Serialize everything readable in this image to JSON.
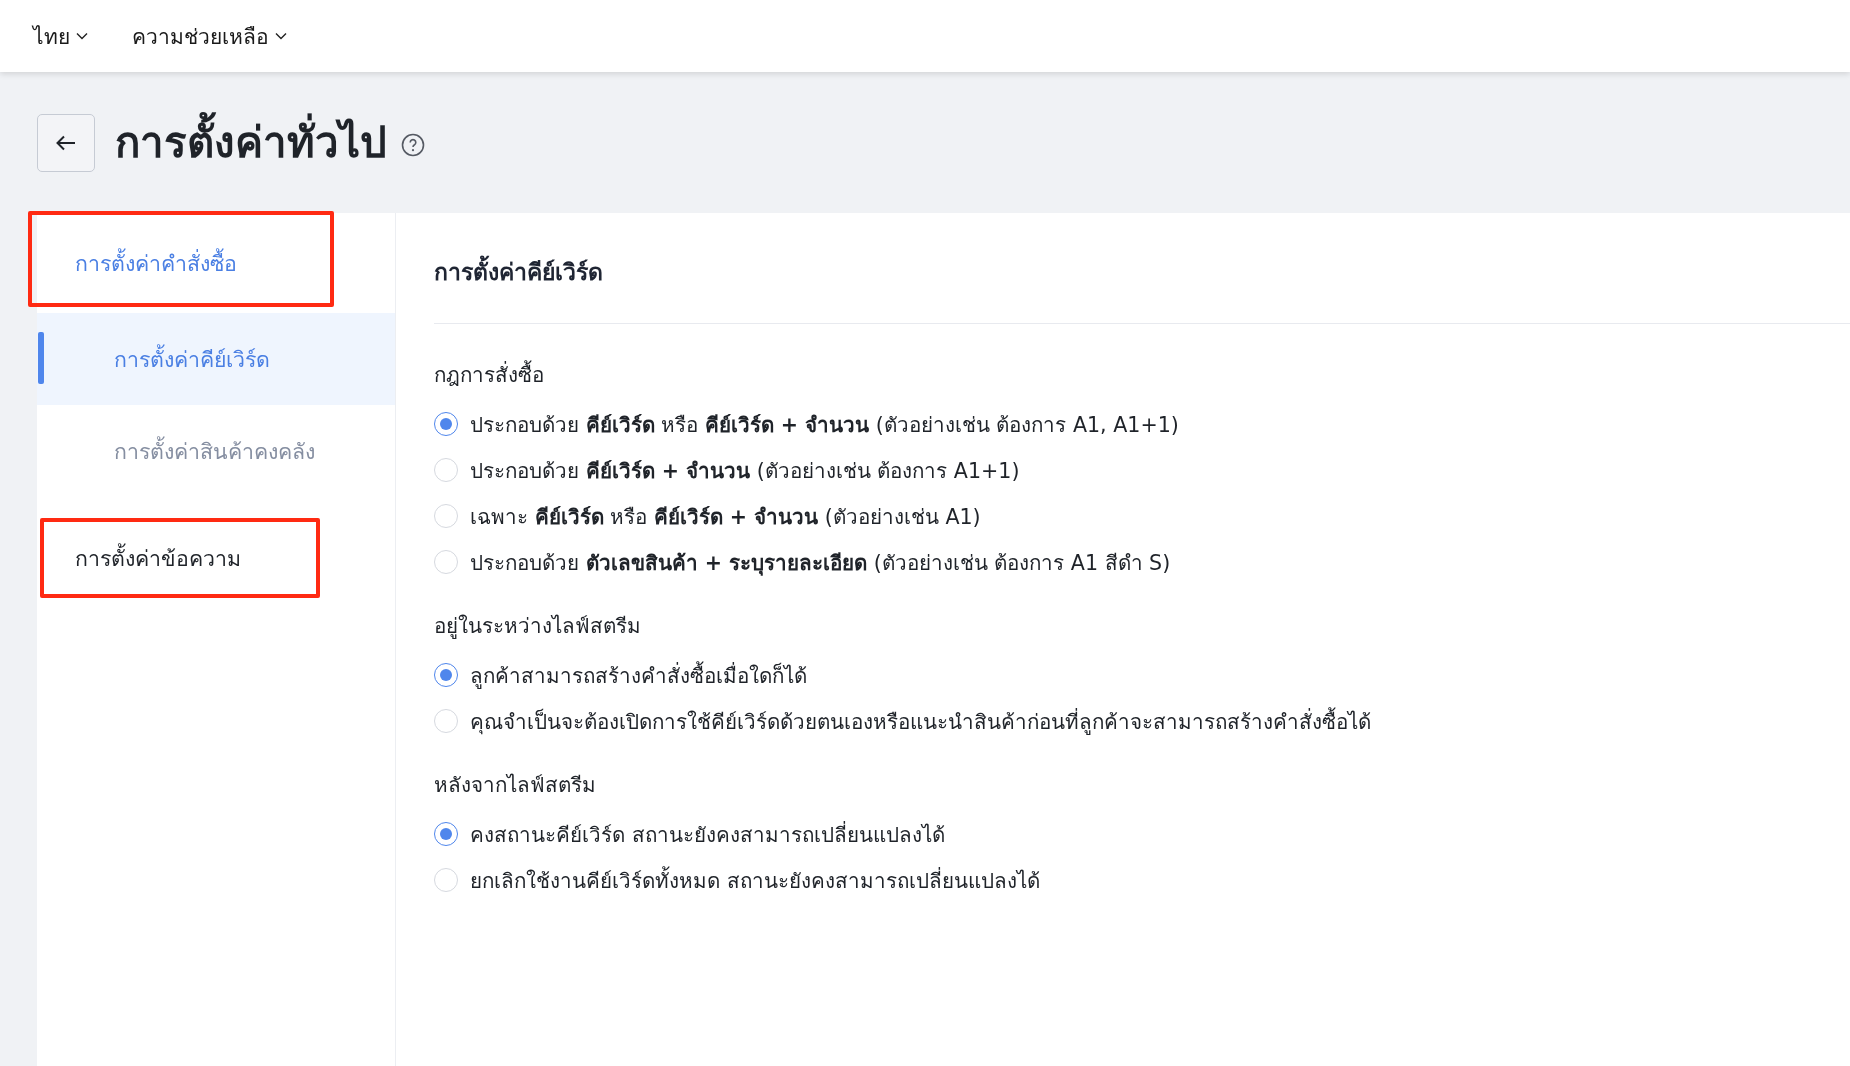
{
  "top_bar": {
    "menus": [
      {
        "label": "ไทย"
      },
      {
        "label": "ความช่วยเหลือ"
      }
    ]
  },
  "header": {
    "title": "การตั้งค่าทั่วไป"
  },
  "sidebar": {
    "items": [
      {
        "label": "การตั้งค่าคำสั่งซื้อ",
        "selected": false,
        "highlighted": true,
        "children": [
          {
            "label": "การตั้งค่าคีย์เวิร์ด",
            "selected": true,
            "highlighted": false
          },
          {
            "label": "การตั้งค่าสินค้าคงคลัง",
            "selected": false,
            "highlighted": false
          }
        ]
      },
      {
        "label": "การตั้งค่าข้อความ",
        "selected": false,
        "highlighted": true
      }
    ]
  },
  "content": {
    "title": "การตั้งค่าคีย์เวิร์ด",
    "groups": [
      {
        "label": "กฎการสั่งซื้อ",
        "options": [
          {
            "text": "ประกอบด้วย **คีย์เวิร์ด** หรือ **คีย์เวิร์ด + จำนวน** (ตัวอย่างเช่น ต้องการ A1, A1+1)",
            "selected": true
          },
          {
            "text": "ประกอบด้วย **คีย์เวิร์ด + จำนวน** (ตัวอย่างเช่น ต้องการ A1+1)",
            "selected": false
          },
          {
            "text": "เฉพาะ **คีย์เวิร์ด** หรือ **คีย์เวิร์ด + จำนวน** (ตัวอย่างเช่น A1)",
            "selected": false
          },
          {
            "text": "ประกอบด้วย **ตัวเลขสินค้า + ระบุรายละเอียด** (ตัวอย่างเช่น ต้องการ A1 สีดำ S)",
            "selected": false
          }
        ]
      },
      {
        "label": "อยู่ในระหว่างไลฟ์สตรีม",
        "options": [
          {
            "text": "ลูกค้าสามารถสร้างคำสั่งซื้อเมื่อใดก็ได้",
            "selected": true
          },
          {
            "text": "คุณจำเป็นจะต้องเปิดการใช้คีย์เวิร์ดด้วยตนเองหรือแนะนำสินค้าก่อนที่ลูกค้าจะสามารถสร้างคำสั่งซื้อได้",
            "selected": false
          }
        ]
      },
      {
        "label": "หลังจากไลฟ์สตรีม",
        "options": [
          {
            "text": "คงสถานะคีย์เวิร์ด สถานะยังคงสามารถเปลี่ยนแปลงได้",
            "selected": true
          },
          {
            "text": "ยกเลิกใช้งานคีย์เวิร์ดทั้งหมด สถานะยังคงสามารถเปลี่ยนแปลงได้",
            "selected": false
          }
        ]
      }
    ]
  }
}
